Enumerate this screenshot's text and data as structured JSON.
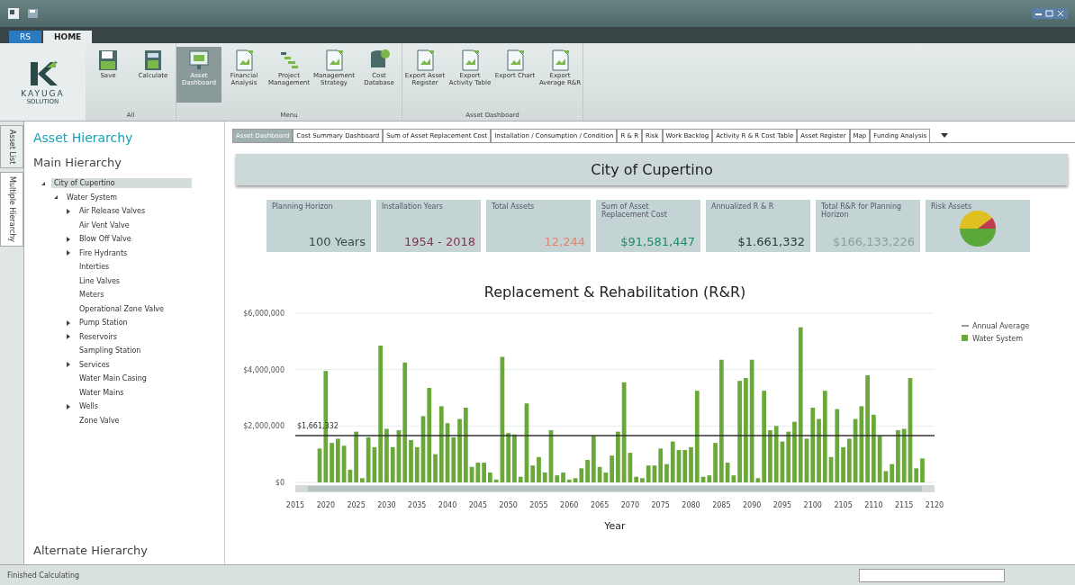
{
  "app_tabs": [
    {
      "label": "RS",
      "selected": false
    },
    {
      "label": "HOME",
      "selected": true
    }
  ],
  "ribbon": {
    "logo": {
      "name": "KAYUGA",
      "tagline": "SOLUTION"
    },
    "groups": [
      {
        "label": "All",
        "buttons": [
          {
            "label": "Save",
            "selected": false
          },
          {
            "label": "Calculate",
            "selected": false
          }
        ]
      },
      {
        "label": "Menu",
        "buttons": [
          {
            "label": "Asset Dashboard",
            "selected": true
          },
          {
            "label": "Financial Analysis",
            "selected": false
          },
          {
            "label": "Project Management",
            "selected": false
          },
          {
            "label": "Management Strategy",
            "selected": false
          },
          {
            "label": "Cost Database",
            "selected": false
          }
        ]
      },
      {
        "label": "Asset Dashboard",
        "buttons": [
          {
            "label": "Export Asset Register",
            "selected": false
          },
          {
            "label": "Export Activity Table",
            "selected": false
          },
          {
            "label": "Export Chart",
            "selected": false
          },
          {
            "label": "Export Average R&R",
            "selected": false
          }
        ]
      }
    ]
  },
  "side_tabs": [
    {
      "label": "Asset List",
      "selected": false
    },
    {
      "label": "Multiple Hierarchy",
      "selected": true
    }
  ],
  "sidebar": {
    "title": "Asset Hierarchy",
    "section": "Main Hierarchy",
    "footer": "Alternate Hierarchy",
    "tree": [
      {
        "kind": "branch",
        "label": "City of Cupertino",
        "selected": true,
        "expanded": true,
        "children": [
          {
            "kind": "branch",
            "label": "Water System",
            "selected": false,
            "expanded": true,
            "children": [
              {
                "kind": "branch",
                "label": "Air Release Valves",
                "selected": false,
                "expanded": false
              },
              {
                "kind": "leaf",
                "label": "Air Vent Valve",
                "selected": false
              },
              {
                "kind": "branch",
                "label": "Blow Off Valve",
                "selected": false,
                "expanded": false
              },
              {
                "kind": "branch",
                "label": "Fire Hydrants",
                "selected": false,
                "expanded": false
              },
              {
                "kind": "leaf",
                "label": "Interties",
                "selected": false
              },
              {
                "kind": "leaf",
                "label": "Line Valves",
                "selected": false
              },
              {
                "kind": "leaf",
                "label": "Meters",
                "selected": false
              },
              {
                "kind": "leaf",
                "label": "Operational Zone Valve",
                "selected": false
              },
              {
                "kind": "branch",
                "label": "Pump Station",
                "selected": false,
                "expanded": false
              },
              {
                "kind": "branch",
                "label": "Reservoirs",
                "selected": false,
                "expanded": false
              },
              {
                "kind": "leaf",
                "label": "Sampling Station",
                "selected": false
              },
              {
                "kind": "branch",
                "label": "Services",
                "selected": false,
                "expanded": false
              },
              {
                "kind": "leaf",
                "label": "Water Main Casing",
                "selected": false
              },
              {
                "kind": "leaf",
                "label": "Water Mains",
                "selected": false
              },
              {
                "kind": "branch",
                "label": "Wells",
                "selected": false,
                "expanded": false
              },
              {
                "kind": "leaf",
                "label": "Zone Valve",
                "selected": false
              }
            ]
          }
        ]
      }
    ]
  },
  "tabs": [
    {
      "label": "Asset Dashboard",
      "selected": true
    },
    {
      "label": "Cost Summary Dashboard",
      "selected": false
    },
    {
      "label": "Sum of Asset Replacement Cost",
      "selected": false
    },
    {
      "label": "Installation / Consumption / Condition",
      "selected": false
    },
    {
      "label": "R & R",
      "selected": false
    },
    {
      "label": "Risk",
      "selected": false
    },
    {
      "label": "Work Backlog",
      "selected": false
    },
    {
      "label": "Activity R & R Cost Table",
      "selected": false
    },
    {
      "label": "Asset Register",
      "selected": false
    },
    {
      "label": "Map",
      "selected": false
    },
    {
      "label": "Funding Analysis",
      "selected": false
    }
  ],
  "heading": "City of Cupertino",
  "cards": [
    {
      "kind": "value",
      "label": "Planning Horizon",
      "value": "100 Years",
      "color": "#3a4a4a"
    },
    {
      "kind": "value",
      "label": "Installation Years",
      "value": "1954 - 2018",
      "color": "#8a3050"
    },
    {
      "kind": "value",
      "label": "Total Assets",
      "value": "12,244",
      "color": "#e8826a"
    },
    {
      "kind": "value",
      "label": "Sum of Asset Replacement Cost",
      "value": "$91,581,447",
      "color": "#1e8a6a"
    },
    {
      "kind": "value",
      "label": "Annualized R & R",
      "value": "$1.661,332",
      "color": "#2a3a3a"
    },
    {
      "kind": "value",
      "label": "Total R&R for Planning Horizon",
      "value": "$166,133,226",
      "color": "#8aa09a"
    },
    {
      "kind": "pie",
      "label": "Risk Assets"
    }
  ],
  "chart_data": {
    "type": "bar",
    "title": "Replacement & Rehabilitation (R&R)",
    "xlabel": "Year",
    "xlim": [
      2015,
      2120
    ],
    "ylim": [
      0,
      6000000
    ],
    "xticks": [
      2015,
      2020,
      2025,
      2030,
      2035,
      2040,
      2045,
      2050,
      2055,
      2060,
      2065,
      2070,
      2075,
      2080,
      2085,
      2090,
      2095,
      2100,
      2105,
      2110,
      2115,
      2120
    ],
    "yticks": [
      {
        "value": 0,
        "label": "$0"
      },
      {
        "value": 2000000,
        "label": "$2,000,000"
      },
      {
        "value": 4000000,
        "label": "$4,000,000"
      },
      {
        "value": 6000000,
        "label": "$6,000,000"
      }
    ],
    "x": [
      2019,
      2020,
      2021,
      2022,
      2023,
      2024,
      2025,
      2026,
      2027,
      2028,
      2029,
      2030,
      2031,
      2032,
      2033,
      2034,
      2035,
      2036,
      2037,
      2038,
      2039,
      2040,
      2041,
      2042,
      2043,
      2044,
      2045,
      2046,
      2047,
      2048,
      2049,
      2050,
      2051,
      2052,
      2053,
      2054,
      2055,
      2056,
      2057,
      2058,
      2059,
      2060,
      2061,
      2062,
      2063,
      2064,
      2065,
      2066,
      2067,
      2068,
      2069,
      2070,
      2071,
      2072,
      2073,
      2074,
      2075,
      2076,
      2077,
      2078,
      2079,
      2080,
      2081,
      2082,
      2083,
      2084,
      2085,
      2086,
      2087,
      2088,
      2089,
      2090,
      2091,
      2092,
      2093,
      2094,
      2095,
      2096,
      2097,
      2098,
      2099,
      2100,
      2101,
      2102,
      2103,
      2104,
      2105,
      2106,
      2107,
      2108,
      2109,
      2110,
      2111,
      2112,
      2113,
      2114,
      2115,
      2116,
      2117,
      2118
    ],
    "series": [
      {
        "name": "Water System",
        "color": "#6aa83a",
        "values": [
          1200000,
          3950000,
          1400000,
          1550000,
          1300000,
          450000,
          1800000,
          150000,
          1600000,
          1250000,
          4850000,
          1900000,
          1250000,
          1850000,
          4250000,
          1500000,
          1250000,
          2350000,
          3350000,
          1000000,
          2700000,
          2100000,
          1600000,
          2250000,
          2650000,
          550000,
          700000,
          700000,
          350000,
          100000,
          4450000,
          1750000,
          1700000,
          200000,
          2800000,
          600000,
          900000,
          350000,
          1850000,
          250000,
          350000,
          100000,
          150000,
          500000,
          800000,
          1650000,
          550000,
          350000,
          950000,
          1800000,
          3550000,
          1050000,
          200000,
          150000,
          600000,
          600000,
          1200000,
          650000,
          1450000,
          1150000,
          1150000,
          1250000,
          3250000,
          200000,
          250000,
          1400000,
          4350000,
          700000,
          250000,
          3600000,
          3700000,
          4350000,
          150000,
          3250000,
          1850000,
          2000000,
          1450000,
          1800000,
          2150000,
          5500000,
          1550000,
          2650000,
          2250000,
          3250000,
          900000,
          2600000,
          1250000,
          1550000,
          2250000,
          2700000,
          3800000,
          2400000,
          1650000,
          400000,
          650000,
          1850000,
          1900000,
          3700000,
          500000,
          850000
        ]
      }
    ],
    "ref_lines": [
      {
        "axis": "y",
        "value": 1661332,
        "label": "$1,661,332"
      }
    ]
  },
  "ref_line_legend": "Annual Average",
  "status_bar": "Finished Calculating"
}
